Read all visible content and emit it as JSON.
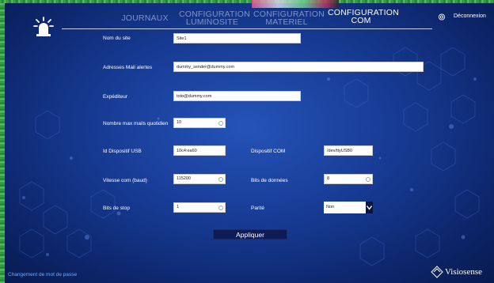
{
  "nav": {
    "items": [
      {
        "label_1": "JOURNAUX",
        "label_2": "",
        "active": false
      },
      {
        "label_1": "CONFIGURATION",
        "label_2": "LUMINOSITE",
        "active": false
      },
      {
        "label_1": "CONFIGURATION",
        "label_2": "MATERIEL",
        "active": false
      },
      {
        "label_1": "CONFIGURATION",
        "label_2": "COM",
        "active": true
      }
    ],
    "logout_label": "Déconnexion"
  },
  "form": {
    "site_name": {
      "label": "Nom du site",
      "value": "Site1"
    },
    "alert_mails": {
      "label": "Adresses Mail alertes",
      "value": "dummy_sender@dummy.com"
    },
    "sender": {
      "label": "Expéditeur",
      "value": "toto@dummy.com"
    },
    "max_mails": {
      "label": "Nombre max mails quotidien",
      "value": "10"
    },
    "usb_id": {
      "label": "Id Dispositif USB",
      "value": "10c4:ea60"
    },
    "com_device": {
      "label": "Dispositif COM",
      "value": "/dev/ttyUSB0"
    },
    "baud": {
      "label": "Vitesse com (baud)",
      "value": "115200"
    },
    "data_bits": {
      "label": "Bits de données",
      "value": "8"
    },
    "stop_bits": {
      "label": "Bits de stop",
      "value": "1"
    },
    "parity": {
      "label": "Parité",
      "value": "Non"
    }
  },
  "apply_label": "Appliquer",
  "change_password_label": "Changement de mot de passe",
  "brand_name": "Visiosense",
  "colors": {
    "background": "#163a92",
    "link": "#6fa8ff",
    "nav_inactive": "#7e93c9",
    "button": "#0d1c55"
  }
}
